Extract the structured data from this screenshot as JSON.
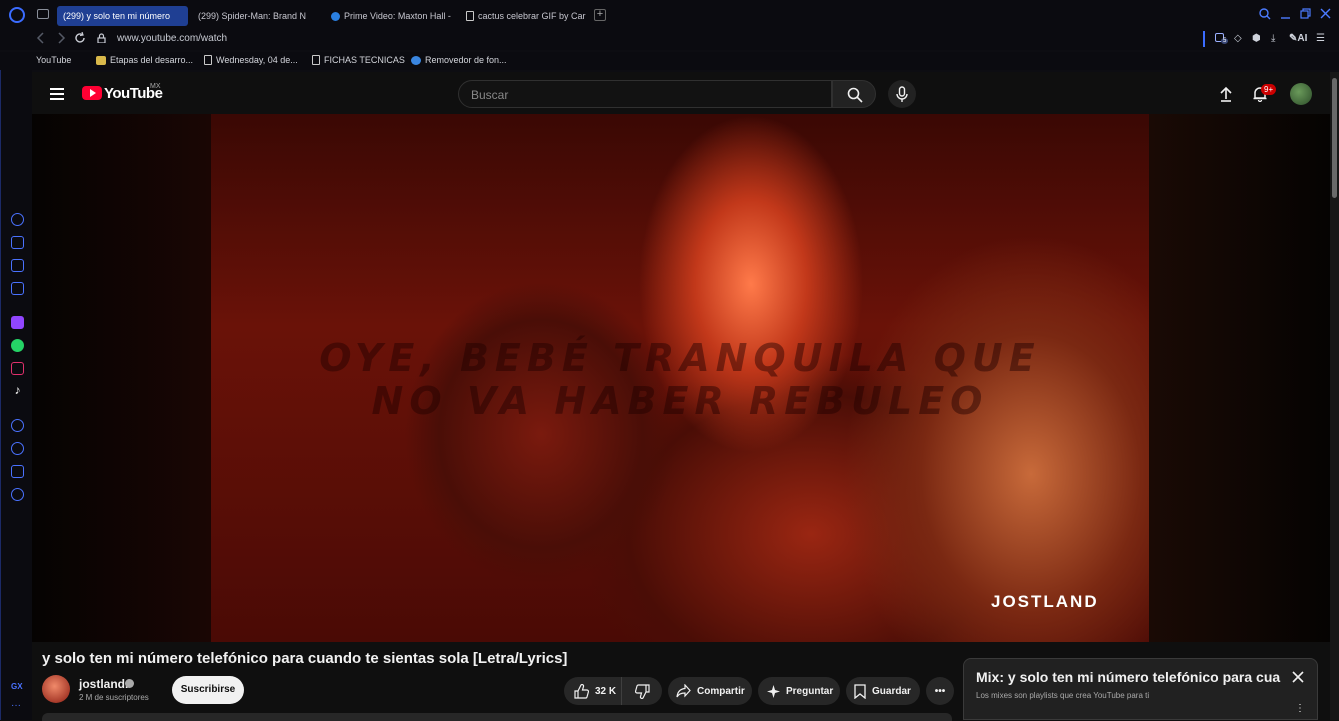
{
  "browser": {
    "tabs": [
      {
        "title": "(299) y solo ten mi número",
        "favicon": "youtube-icon",
        "active": true
      },
      {
        "title": "(299) Spider-Man: Brand N",
        "favicon": "youtube-icon",
        "active": false
      },
      {
        "title": "Prime Video: Maxton Hall -",
        "favicon": "prime-video-icon",
        "active": false
      },
      {
        "title": "cactus celebrar GIF by Car",
        "favicon": "document-icon",
        "active": false
      }
    ],
    "url": "www.youtube.com/watch",
    "extensions": {
      "badge": "5",
      "ai_label": "AI"
    },
    "bookmarks": [
      {
        "label": "YouTube",
        "icon": "youtube-icon"
      },
      {
        "label": "Etapas del desarro...",
        "icon": "folder-icon"
      },
      {
        "label": "Wednesday, 04 de...",
        "icon": "document-icon"
      },
      {
        "label": "FICHAS TECNICAS",
        "icon": "document-icon"
      },
      {
        "label": "Removedor de fon...",
        "icon": "globe-icon"
      }
    ],
    "sidebar": {
      "gx_label": "GX",
      "more_label": "···"
    }
  },
  "youtube": {
    "brand": "YouTube",
    "country": "MX",
    "search_placeholder": "Buscar",
    "notification_count": "9+",
    "video": {
      "lyric_line_1": "OYE, BEBÉ TRANQUILA QUE",
      "lyric_line_2": "NO VA HABER REBULEO",
      "watermark": "JOSTLAND"
    },
    "title": "y solo ten mi número telefónico para cuando te sientas sola [Letra/Lyrics]",
    "channel": {
      "name": "jostland.",
      "subscribers": "2 M de suscriptores"
    },
    "subscribe_label": "Suscribirse",
    "actions": {
      "likes": "32 K",
      "share": "Compartir",
      "ask": "Preguntar",
      "save": "Guardar"
    },
    "mix": {
      "title": "Mix: y solo ten mi número telefónico para cuando te sientas sola",
      "subtitle": "Los mixes son playlists que crea YouTube para ti"
    }
  },
  "colors": {
    "accent": "#3b6cff",
    "youtube_red": "#ff0033",
    "active_tab": "#1f3f93"
  }
}
